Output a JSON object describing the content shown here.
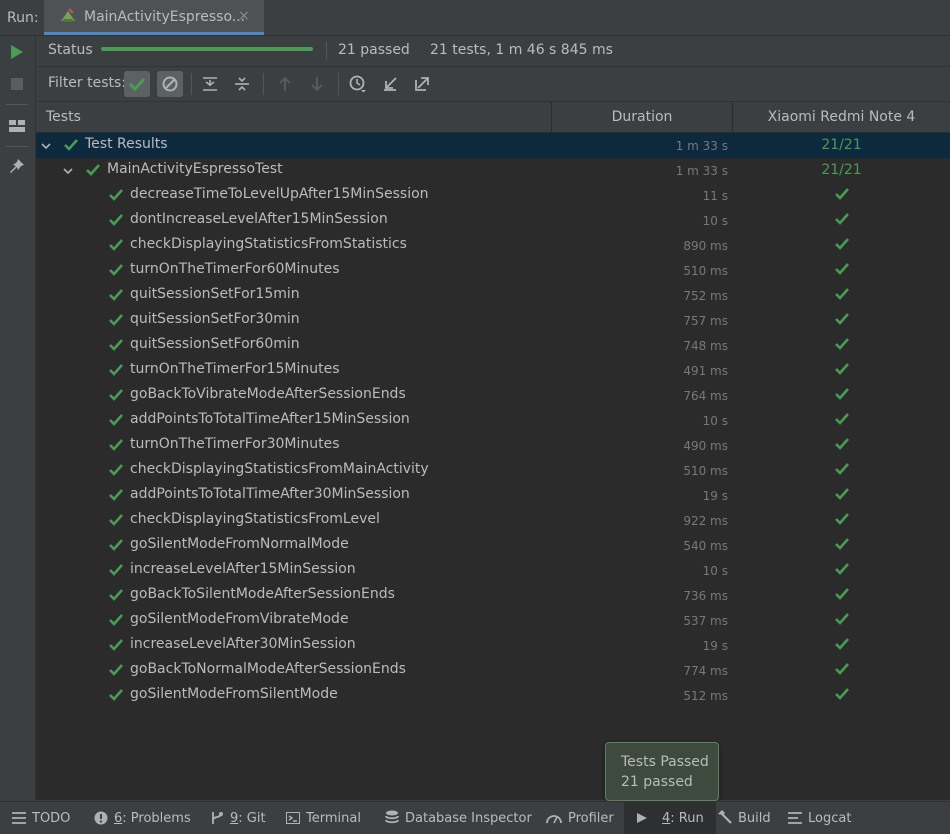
{
  "topbar": {
    "run_label": "Run:",
    "tab_title": "MainActivityEspresso...",
    "tab_close": "×"
  },
  "status": {
    "label": "Status",
    "passed": "21 passed",
    "summary": "21 tests, 1 m 46 s 845 ms",
    "progress": 1.0
  },
  "filter": {
    "label": "Filter tests:"
  },
  "table": {
    "col_tests": "Tests",
    "col_duration": "Duration",
    "col_device": "Xiaomi Redmi Note 4"
  },
  "tree": {
    "root": {
      "name": "Test Results",
      "duration": "1 m 33 s",
      "result": "21/21"
    },
    "suite": {
      "name": "MainActivityEspressoTest",
      "duration": "1 m 33 s",
      "result": "21/21"
    },
    "tests": [
      {
        "name": "decreaseTimeToLevelUpAfter15MinSession",
        "duration": "11 s"
      },
      {
        "name": "dontIncreaseLevelAfter15MinSession",
        "duration": "10 s"
      },
      {
        "name": "checkDisplayingStatisticsFromStatistics",
        "duration": "890 ms"
      },
      {
        "name": "turnOnTheTimerFor60Minutes",
        "duration": "510 ms"
      },
      {
        "name": "quitSessionSetFor15min",
        "duration": "752 ms"
      },
      {
        "name": "quitSessionSetFor30min",
        "duration": "757 ms"
      },
      {
        "name": "quitSessionSetFor60min",
        "duration": "748 ms"
      },
      {
        "name": "turnOnTheTimerFor15Minutes",
        "duration": "491 ms"
      },
      {
        "name": "goBackToVibrateModeAfterSessionEnds",
        "duration": "764 ms"
      },
      {
        "name": "addPointsToTotalTimeAfter15MinSession",
        "duration": "10 s"
      },
      {
        "name": "turnOnTheTimerFor30Minutes",
        "duration": "490 ms"
      },
      {
        "name": "checkDisplayingStatisticsFromMainActivity",
        "duration": "510 ms"
      },
      {
        "name": "addPointsToTotalTimeAfter30MinSession",
        "duration": "19 s"
      },
      {
        "name": "checkDisplayingStatisticsFromLevel",
        "duration": "922 ms"
      },
      {
        "name": "goSilentModeFromNormalMode",
        "duration": "540 ms"
      },
      {
        "name": "increaseLevelAfter15MinSession",
        "duration": "10 s"
      },
      {
        "name": "goBackToSilentModeAfterSessionEnds",
        "duration": "736 ms"
      },
      {
        "name": "goSilentModeFromVibrateMode",
        "duration": "537 ms"
      },
      {
        "name": "increaseLevelAfter30MinSession",
        "duration": "19 s"
      },
      {
        "name": "goBackToNormalModeAfterSessionEnds",
        "duration": "774 ms"
      },
      {
        "name": "goSilentModeFromSilentMode",
        "duration": "512 ms"
      }
    ]
  },
  "tooltip": {
    "title": "Tests Passed",
    "subtitle": "21 passed"
  },
  "bottombar": {
    "todo": "TODO",
    "problems_num": "6",
    "problems_label": ": Problems",
    "git_num": "9",
    "git_label": ": Git",
    "terminal": "Terminal",
    "database": "Database Inspector",
    "profiler": "Profiler",
    "run_num": "4",
    "run_label": ": Run",
    "build": "Build",
    "logcat": "Logcat"
  },
  "colors": {
    "pass_green": "#499c54",
    "selection": "#0d293e",
    "background": "#2b2b2b",
    "panel": "#3c3f41"
  }
}
